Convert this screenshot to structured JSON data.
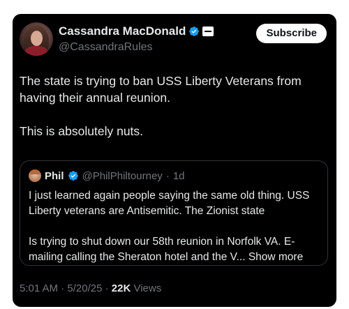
{
  "author": {
    "display_name": "Cassandra MacDonald",
    "handle": "@CassandraRules",
    "verified": true
  },
  "actions": {
    "subscribe_label": "Subscribe"
  },
  "tweet": {
    "paragraphs": [
      "The state is trying to ban USS Liberty Veterans from having their annual reunion.",
      "This is absolutely nuts."
    ],
    "time": "5:01 AM",
    "date": "5/20/25",
    "views_count": "22K",
    "views_label": "Views",
    "separator": " · "
  },
  "quote": {
    "display_name": "Phil",
    "handle": "@PhilPhiltourney",
    "age": "1d",
    "separator": "·",
    "paragraphs": [
      "I just learned again people saying the same old thing. USS Liberty veterans are Antisemitic. The Zionist state",
      "Is trying to shut down our 58th reunion in Norfolk VA. E-mailing calling the Sheraton hotel and the V..."
    ],
    "show_more_label": "Show more"
  },
  "colors": {
    "background": "#000000",
    "text": "#e7e9ea",
    "muted": "#71767b",
    "verified_blue": "#1d9bf0",
    "border": "#2f3336"
  }
}
